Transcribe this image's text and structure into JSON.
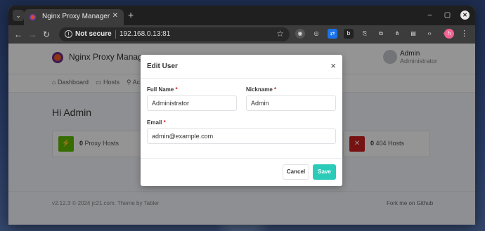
{
  "browser": {
    "tab_title": "Nginx Proxy Manager",
    "tab_close": "✕",
    "new_tab": "+",
    "security_label": "Not secure",
    "url": "192.168.0.13:81",
    "profile_initial": "h"
  },
  "app": {
    "brand": "Nginx Proxy Manager",
    "user_name": "Admin",
    "user_role": "Administrator",
    "nav": {
      "dashboard": "Dashboard",
      "hosts": "Hosts",
      "access": "Ac"
    },
    "greeting": "Hi Admin",
    "cards": {
      "proxy_count": "0",
      "proxy_label": "Proxy Hosts",
      "n404_count": "0",
      "n404_label": "404 Hosts"
    },
    "footer_left": "v2.12.3 © 2024 jc21.com. Theme by Tabler",
    "footer_right": "Fork me on Github"
  },
  "modal": {
    "title": "Edit User",
    "close": "×",
    "full_name_label": "Full Name",
    "full_name_value": "Administrator",
    "nickname_label": "Nickname",
    "nickname_value": "Admin",
    "email_label": "Email",
    "email_value": "admin@example.com",
    "required_mark": "*",
    "cancel_label": "Cancel",
    "save_label": "Save"
  },
  "colors": {
    "accent": "#2bcbba",
    "proxy_icon": "#5eba00",
    "n404_icon": "#cd201f"
  }
}
